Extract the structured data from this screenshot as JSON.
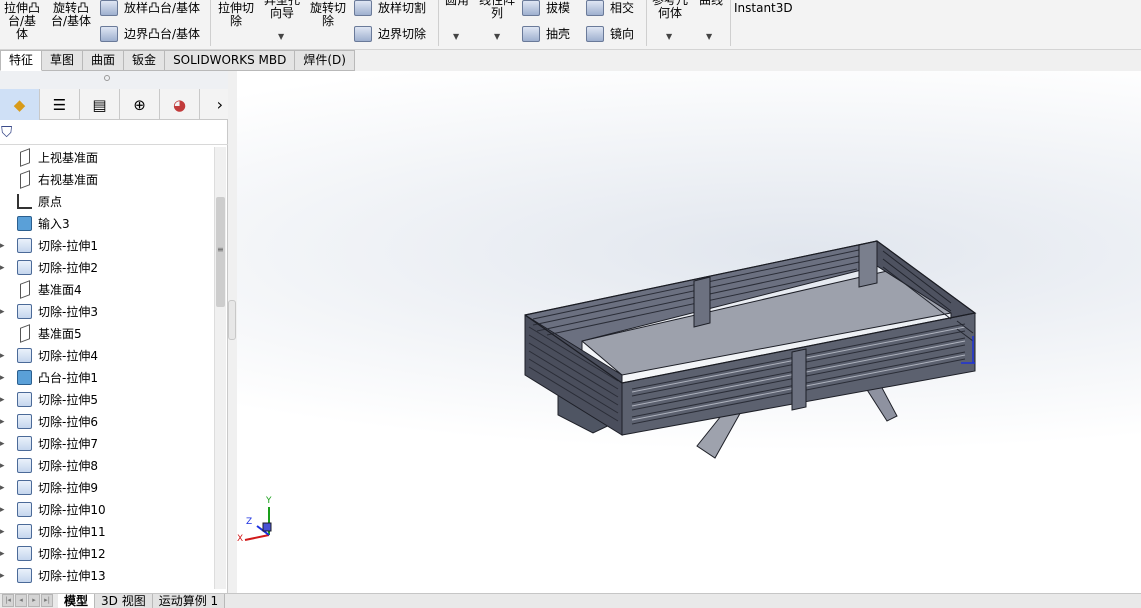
{
  "ribbon": {
    "extrude_boss": "拉伸凸\n台/基体",
    "revolve_boss": "旋转凸\n台/基体",
    "loft_boss": "放样凸台/基体",
    "boundary_boss": "边界凸台/基体",
    "extrude_cut": "拉伸切\n除",
    "hole_wizard": "异型孔\n向导",
    "revolve_cut": "旋转切\n除",
    "loft_cut": "放样切割",
    "boundary_cut": "边界切除",
    "fillet": "圆角",
    "linear_pattern": "线性阵\n列",
    "draft": "拔模",
    "shell": "抽壳",
    "intersect": "相交",
    "mirror": "镜向",
    "ref_geometry": "参考几\n何体",
    "curves": "曲线",
    "instant3d": "Instant3D"
  },
  "tabs": [
    "特征",
    "草图",
    "曲面",
    "钣金",
    "SOLIDWORKS MBD",
    "焊件(D)"
  ],
  "active_tab": "特征",
  "tree": [
    {
      "label": "上视基准面",
      "icon": "plane-icon",
      "expand": false
    },
    {
      "label": "右视基准面",
      "icon": "plane-icon",
      "expand": false
    },
    {
      "label": "原点",
      "icon": "origin-icon",
      "expand": false
    },
    {
      "label": "输入3",
      "icon": "part-icon",
      "expand": false
    },
    {
      "label": "切除-拉伸1",
      "icon": "cut-extrude-icon",
      "expand": true
    },
    {
      "label": "切除-拉伸2",
      "icon": "cut-extrude-icon",
      "expand": true
    },
    {
      "label": "基准面4",
      "icon": "plane-icon",
      "expand": false
    },
    {
      "label": "切除-拉伸3",
      "icon": "cut-extrude-icon",
      "expand": true
    },
    {
      "label": "基准面5",
      "icon": "plane-icon",
      "expand": false
    },
    {
      "label": "切除-拉伸4",
      "icon": "cut-extrude-icon",
      "expand": true
    },
    {
      "label": "凸台-拉伸1",
      "icon": "boss-extrude-icon",
      "expand": true
    },
    {
      "label": "切除-拉伸5",
      "icon": "cut-extrude-icon",
      "expand": true
    },
    {
      "label": "切除-拉伸6",
      "icon": "cut-extrude-icon",
      "expand": true
    },
    {
      "label": "切除-拉伸7",
      "icon": "cut-extrude-icon",
      "expand": true
    },
    {
      "label": "切除-拉伸8",
      "icon": "cut-extrude-icon",
      "expand": true
    },
    {
      "label": "切除-拉伸9",
      "icon": "cut-extrude-icon",
      "expand": true
    },
    {
      "label": "切除-拉伸10",
      "icon": "cut-extrude-icon",
      "expand": true
    },
    {
      "label": "切除-拉伸11",
      "icon": "cut-extrude-icon",
      "expand": true
    },
    {
      "label": "切除-拉伸12",
      "icon": "cut-extrude-icon",
      "expand": true
    },
    {
      "label": "切除-拉伸13",
      "icon": "cut-extrude-icon",
      "expand": true
    }
  ],
  "bottom_tabs": [
    "模型",
    "3D 视图",
    "运动算例 1"
  ],
  "triad": {
    "x": "X",
    "y": "Y",
    "z": "Z"
  }
}
